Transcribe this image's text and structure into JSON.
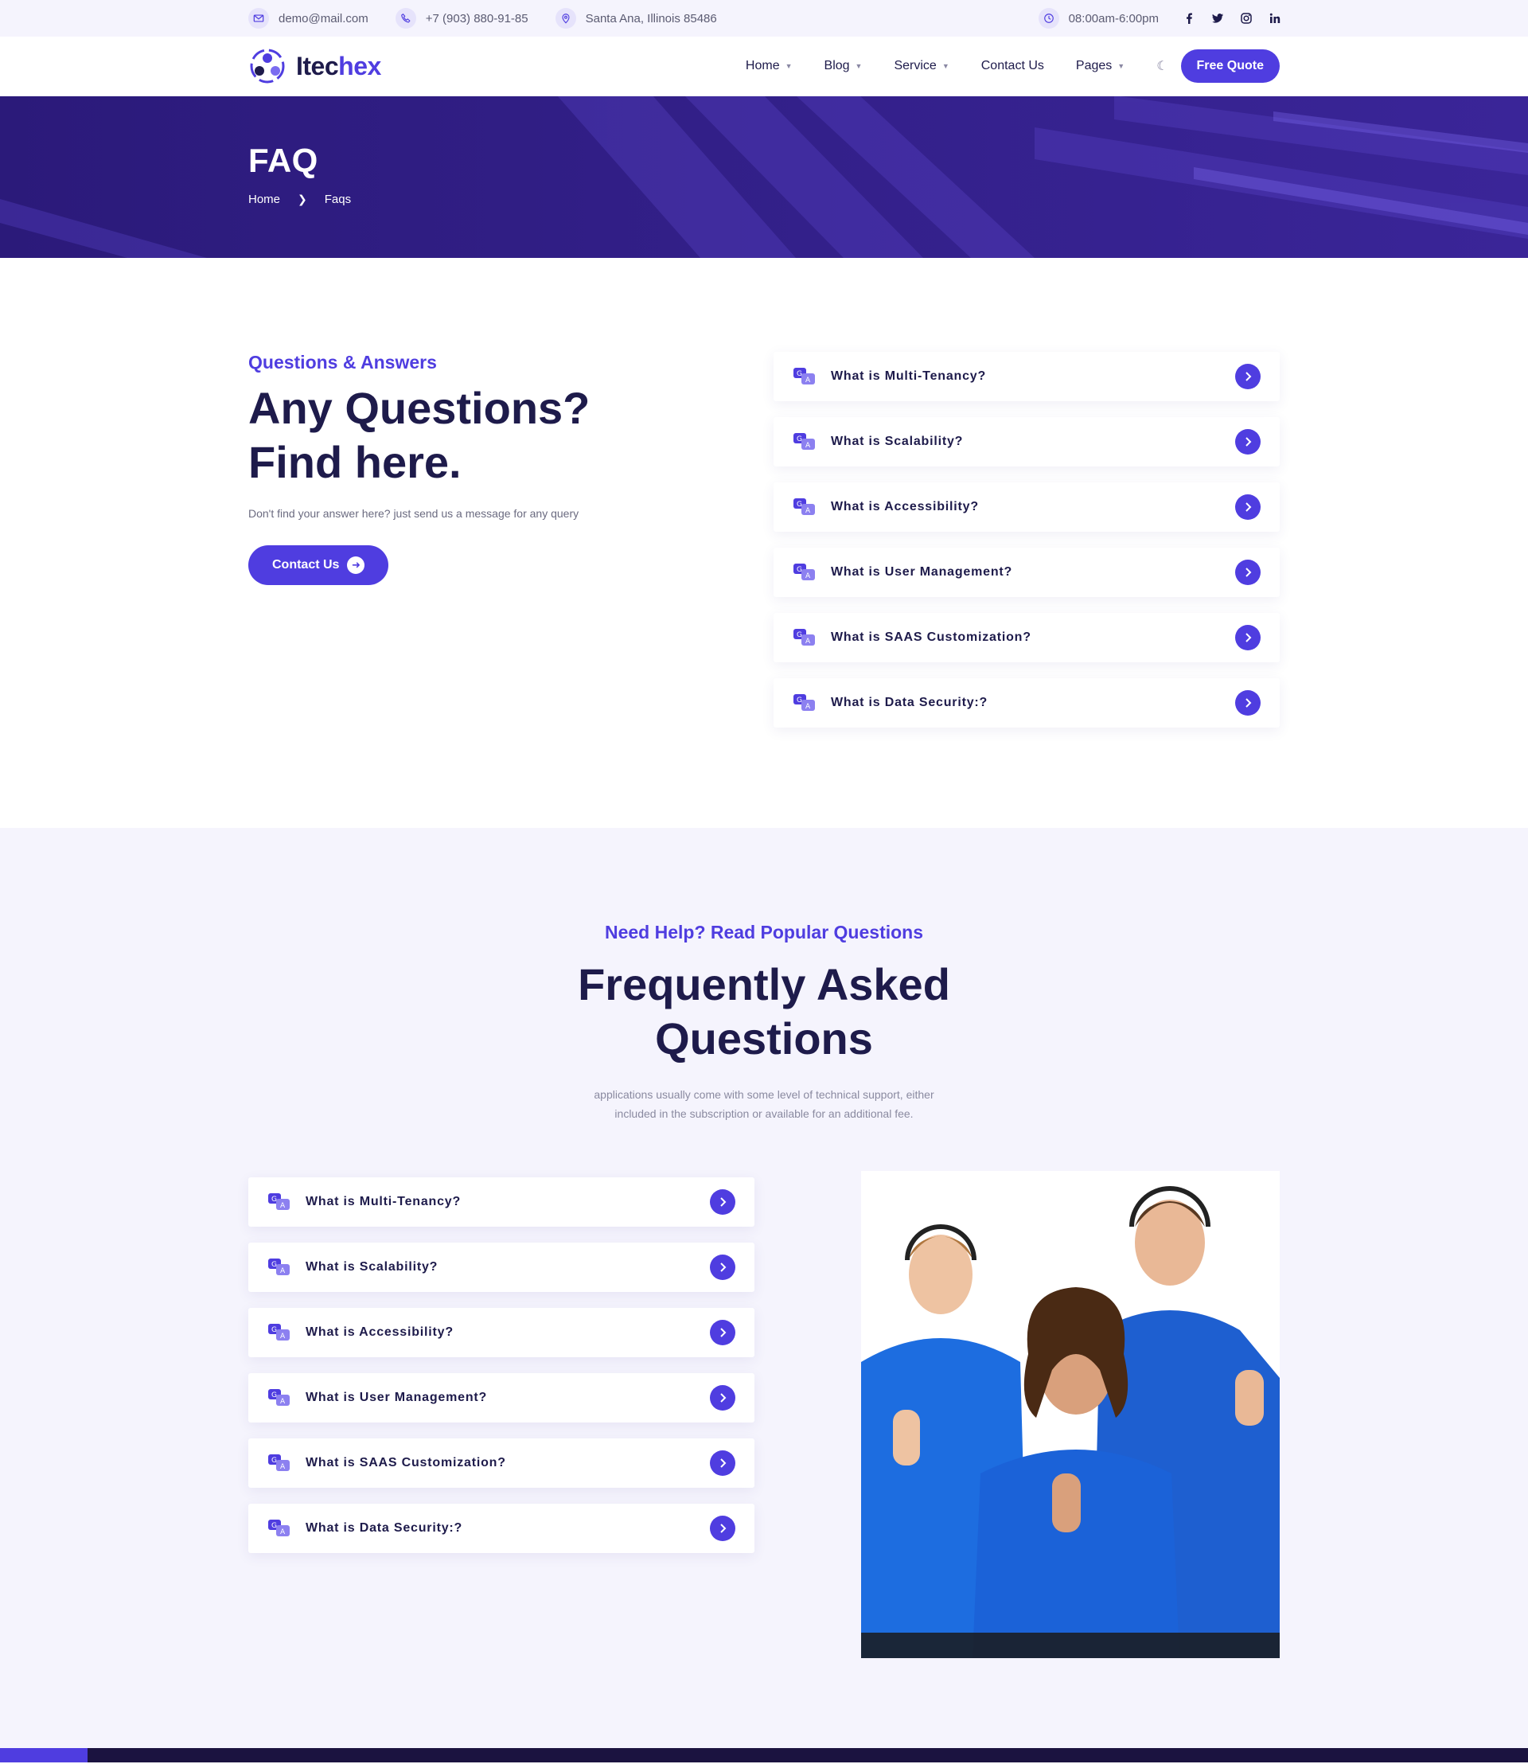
{
  "topbar": {
    "email": "demo@mail.com",
    "phone": "+7 (903) 880-91-85",
    "address": "Santa Ana, Illinois 85486",
    "hours": "08:00am-6:00pm",
    "social": [
      "facebook-icon",
      "twitter-icon",
      "instagram-icon",
      "linkedin-icon"
    ]
  },
  "nav": {
    "logo_main": "Itec",
    "logo_accent": "hex",
    "items": [
      {
        "label": "Home",
        "dropdown": true
      },
      {
        "label": "Blog",
        "dropdown": true
      },
      {
        "label": "Service",
        "dropdown": true
      },
      {
        "label": "Contact Us",
        "dropdown": false
      },
      {
        "label": "Pages",
        "dropdown": true
      }
    ],
    "theme_toggle_icon": "moon-icon",
    "cta": "Free Quote"
  },
  "hero": {
    "title": "FAQ",
    "breadcrumb": [
      "Home",
      "Faqs"
    ]
  },
  "section1": {
    "eyebrow": "Questions & Answers",
    "title_line1": "Any Questions?",
    "title_line2": "Find here.",
    "description": "Don't find your answer here? just send us a message for any query",
    "button": "Contact Us",
    "faqs": [
      "What is Multi-Tenancy?",
      "What is Scalability?",
      "What is Accessibility?",
      "What is User Management?",
      "What is SAAS Customization?",
      "What is Data Security:?"
    ]
  },
  "section2": {
    "eyebrow": "Need Help? Read Popular Questions",
    "title_line1": "Frequently Asked",
    "title_line2": "Questions",
    "desc_line1": "applications usually come with some level of technical support, either",
    "desc_line2": "included in the subscription or available for an additional fee.",
    "faqs": [
      "What is Multi-Tenancy?",
      "What is Scalability?",
      "What is Accessibility?",
      "What is User Management?",
      "What is SAAS Customization?",
      "What is Data Security:?"
    ]
  },
  "colors": {
    "accent": "#4f3de0",
    "dark": "#1e1b4b",
    "hero_bg": "#2b1a7a",
    "section_bg": "#f5f4fd"
  }
}
